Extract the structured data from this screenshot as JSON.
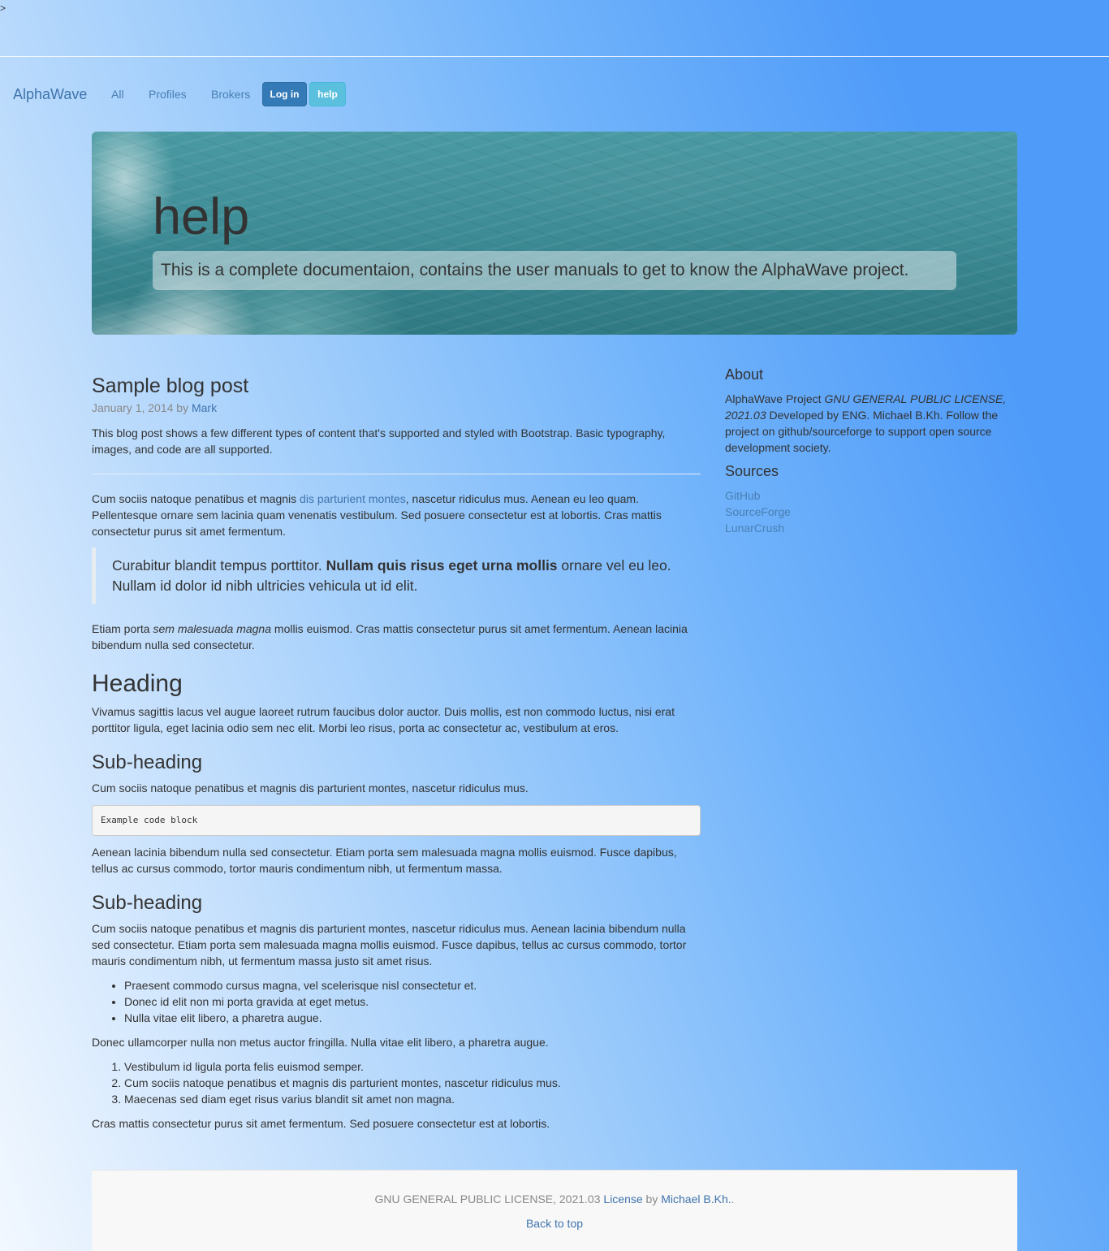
{
  "stray_text": ">",
  "navbar": {
    "brand": "AlphaWave",
    "links": [
      "All",
      "Profiles",
      "Brokers"
    ],
    "login_button": "Log in",
    "help_button": "help"
  },
  "jumbotron": {
    "title": "help",
    "lead": "This is a complete documentaion, contains the user manuals to get to know the AlphaWave project."
  },
  "post": {
    "title": "Sample blog post",
    "date": "January 1, 2014 by ",
    "author": "Mark",
    "intro": "This blog post shows a few different types of content that's supported and styled with Bootstrap. Basic typography, images, and code are all supported.",
    "p2_before": "Cum sociis natoque penatibus et magnis ",
    "p2_link": "dis parturient montes",
    "p2_after": ", nascetur ridiculus mus. Aenean eu leo quam. Pellentesque ornare sem lacinia quam venenatis vestibulum. Sed posuere consectetur est at lobortis. Cras mattis consectetur purus sit amet fermentum.",
    "quote_before": "Curabitur blandit tempus porttitor. ",
    "quote_bold": "Nullam quis risus eget urna mollis",
    "quote_after": " ornare vel eu leo. Nullam id dolor id nibh ultricies vehicula ut id elit.",
    "p3_before": "Etiam porta ",
    "p3_em": "sem malesuada magna",
    "p3_after": " mollis euismod. Cras mattis consectetur purus sit amet fermentum. Aenean lacinia bibendum nulla sed consectetur.",
    "heading": "Heading",
    "heading_text": "Vivamus sagittis lacus vel augue laoreet rutrum faucibus dolor auctor. Duis mollis, est non commodo luctus, nisi erat porttitor ligula, eget lacinia odio sem nec elit. Morbi leo risus, porta ac consectetur ac, vestibulum at eros.",
    "subheading1": "Sub-heading",
    "subheading1_text": "Cum sociis natoque penatibus et magnis dis parturient montes, nascetur ridiculus mus.",
    "code": "Example code block",
    "after_code": "Aenean lacinia bibendum nulla sed consectetur. Etiam porta sem malesuada magna mollis euismod. Fusce dapibus, tellus ac cursus commodo, tortor mauris condimentum nibh, ut fermentum massa.",
    "subheading2": "Sub-heading",
    "subheading2_text": "Cum sociis natoque penatibus et magnis dis parturient montes, nascetur ridiculus mus. Aenean lacinia bibendum nulla sed consectetur. Etiam porta sem malesuada magna mollis euismod. Fusce dapibus, tellus ac cursus commodo, tortor mauris condimentum nibh, ut fermentum massa justo sit amet risus.",
    "bullets": [
      "Praesent commodo cursus magna, vel scelerisque nisl consectetur et.",
      "Donec id elit non mi porta gravida at eget metus.",
      "Nulla vitae elit libero, a pharetra augue."
    ],
    "mid_text": "Donec ullamcorper nulla non metus auctor fringilla. Nulla vitae elit libero, a pharetra augue.",
    "numbered": [
      "Vestibulum id ligula porta felis euismod semper.",
      "Cum sociis natoque penatibus et magnis dis parturient montes, nascetur ridiculus mus.",
      "Maecenas sed diam eget risus varius blandit sit amet non magna."
    ],
    "closing": "Cras mattis consectetur purus sit amet fermentum. Sed posuere consectetur est at lobortis."
  },
  "sidebar": {
    "about_title": "About",
    "about_before": "AlphaWave Project ",
    "about_em": "GNU GENERAL PUBLIC LICENSE, 2021.03",
    "about_after": " Developed by ENG. Michael B.Kh. Follow the project on github/sourceforge to support open source development society.",
    "sources_title": "Sources",
    "sources": [
      "GitHub",
      "SourceForge",
      "LunarCrush"
    ]
  },
  "footer": {
    "license_text": "GNU GENERAL PUBLIC LICENSE, 2021.03 ",
    "license_link": "License",
    "by": " by ",
    "author_link": "Michael B.Kh.",
    "trail": ".",
    "back_to_top": "Back to top"
  }
}
